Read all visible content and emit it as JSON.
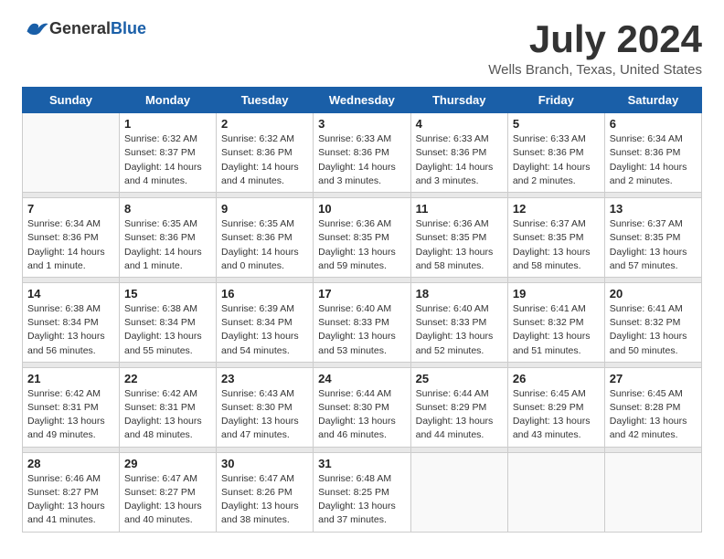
{
  "header": {
    "logo_general": "General",
    "logo_blue": "Blue",
    "month": "July 2024",
    "location": "Wells Branch, Texas, United States"
  },
  "weekdays": [
    "Sunday",
    "Monday",
    "Tuesday",
    "Wednesday",
    "Thursday",
    "Friday",
    "Saturday"
  ],
  "weeks": [
    [
      {
        "day": "",
        "sunrise": "",
        "sunset": "",
        "daylight": ""
      },
      {
        "day": "1",
        "sunrise": "Sunrise: 6:32 AM",
        "sunset": "Sunset: 8:37 PM",
        "daylight": "Daylight: 14 hours and 4 minutes."
      },
      {
        "day": "2",
        "sunrise": "Sunrise: 6:32 AM",
        "sunset": "Sunset: 8:36 PM",
        "daylight": "Daylight: 14 hours and 4 minutes."
      },
      {
        "day": "3",
        "sunrise": "Sunrise: 6:33 AM",
        "sunset": "Sunset: 8:36 PM",
        "daylight": "Daylight: 14 hours and 3 minutes."
      },
      {
        "day": "4",
        "sunrise": "Sunrise: 6:33 AM",
        "sunset": "Sunset: 8:36 PM",
        "daylight": "Daylight: 14 hours and 3 minutes."
      },
      {
        "day": "5",
        "sunrise": "Sunrise: 6:33 AM",
        "sunset": "Sunset: 8:36 PM",
        "daylight": "Daylight: 14 hours and 2 minutes."
      },
      {
        "day": "6",
        "sunrise": "Sunrise: 6:34 AM",
        "sunset": "Sunset: 8:36 PM",
        "daylight": "Daylight: 14 hours and 2 minutes."
      }
    ],
    [
      {
        "day": "7",
        "sunrise": "Sunrise: 6:34 AM",
        "sunset": "Sunset: 8:36 PM",
        "daylight": "Daylight: 14 hours and 1 minute."
      },
      {
        "day": "8",
        "sunrise": "Sunrise: 6:35 AM",
        "sunset": "Sunset: 8:36 PM",
        "daylight": "Daylight: 14 hours and 1 minute."
      },
      {
        "day": "9",
        "sunrise": "Sunrise: 6:35 AM",
        "sunset": "Sunset: 8:36 PM",
        "daylight": "Daylight: 14 hours and 0 minutes."
      },
      {
        "day": "10",
        "sunrise": "Sunrise: 6:36 AM",
        "sunset": "Sunset: 8:35 PM",
        "daylight": "Daylight: 13 hours and 59 minutes."
      },
      {
        "day": "11",
        "sunrise": "Sunrise: 6:36 AM",
        "sunset": "Sunset: 8:35 PM",
        "daylight": "Daylight: 13 hours and 58 minutes."
      },
      {
        "day": "12",
        "sunrise": "Sunrise: 6:37 AM",
        "sunset": "Sunset: 8:35 PM",
        "daylight": "Daylight: 13 hours and 58 minutes."
      },
      {
        "day": "13",
        "sunrise": "Sunrise: 6:37 AM",
        "sunset": "Sunset: 8:35 PM",
        "daylight": "Daylight: 13 hours and 57 minutes."
      }
    ],
    [
      {
        "day": "14",
        "sunrise": "Sunrise: 6:38 AM",
        "sunset": "Sunset: 8:34 PM",
        "daylight": "Daylight: 13 hours and 56 minutes."
      },
      {
        "day": "15",
        "sunrise": "Sunrise: 6:38 AM",
        "sunset": "Sunset: 8:34 PM",
        "daylight": "Daylight: 13 hours and 55 minutes."
      },
      {
        "day": "16",
        "sunrise": "Sunrise: 6:39 AM",
        "sunset": "Sunset: 8:34 PM",
        "daylight": "Daylight: 13 hours and 54 minutes."
      },
      {
        "day": "17",
        "sunrise": "Sunrise: 6:40 AM",
        "sunset": "Sunset: 8:33 PM",
        "daylight": "Daylight: 13 hours and 53 minutes."
      },
      {
        "day": "18",
        "sunrise": "Sunrise: 6:40 AM",
        "sunset": "Sunset: 8:33 PM",
        "daylight": "Daylight: 13 hours and 52 minutes."
      },
      {
        "day": "19",
        "sunrise": "Sunrise: 6:41 AM",
        "sunset": "Sunset: 8:32 PM",
        "daylight": "Daylight: 13 hours and 51 minutes."
      },
      {
        "day": "20",
        "sunrise": "Sunrise: 6:41 AM",
        "sunset": "Sunset: 8:32 PM",
        "daylight": "Daylight: 13 hours and 50 minutes."
      }
    ],
    [
      {
        "day": "21",
        "sunrise": "Sunrise: 6:42 AM",
        "sunset": "Sunset: 8:31 PM",
        "daylight": "Daylight: 13 hours and 49 minutes."
      },
      {
        "day": "22",
        "sunrise": "Sunrise: 6:42 AM",
        "sunset": "Sunset: 8:31 PM",
        "daylight": "Daylight: 13 hours and 48 minutes."
      },
      {
        "day": "23",
        "sunrise": "Sunrise: 6:43 AM",
        "sunset": "Sunset: 8:30 PM",
        "daylight": "Daylight: 13 hours and 47 minutes."
      },
      {
        "day": "24",
        "sunrise": "Sunrise: 6:44 AM",
        "sunset": "Sunset: 8:30 PM",
        "daylight": "Daylight: 13 hours and 46 minutes."
      },
      {
        "day": "25",
        "sunrise": "Sunrise: 6:44 AM",
        "sunset": "Sunset: 8:29 PM",
        "daylight": "Daylight: 13 hours and 44 minutes."
      },
      {
        "day": "26",
        "sunrise": "Sunrise: 6:45 AM",
        "sunset": "Sunset: 8:29 PM",
        "daylight": "Daylight: 13 hours and 43 minutes."
      },
      {
        "day": "27",
        "sunrise": "Sunrise: 6:45 AM",
        "sunset": "Sunset: 8:28 PM",
        "daylight": "Daylight: 13 hours and 42 minutes."
      }
    ],
    [
      {
        "day": "28",
        "sunrise": "Sunrise: 6:46 AM",
        "sunset": "Sunset: 8:27 PM",
        "daylight": "Daylight: 13 hours and 41 minutes."
      },
      {
        "day": "29",
        "sunrise": "Sunrise: 6:47 AM",
        "sunset": "Sunset: 8:27 PM",
        "daylight": "Daylight: 13 hours and 40 minutes."
      },
      {
        "day": "30",
        "sunrise": "Sunrise: 6:47 AM",
        "sunset": "Sunset: 8:26 PM",
        "daylight": "Daylight: 13 hours and 38 minutes."
      },
      {
        "day": "31",
        "sunrise": "Sunrise: 6:48 AM",
        "sunset": "Sunset: 8:25 PM",
        "daylight": "Daylight: 13 hours and 37 minutes."
      },
      {
        "day": "",
        "sunrise": "",
        "sunset": "",
        "daylight": ""
      },
      {
        "day": "",
        "sunrise": "",
        "sunset": "",
        "daylight": ""
      },
      {
        "day": "",
        "sunrise": "",
        "sunset": "",
        "daylight": ""
      }
    ]
  ]
}
